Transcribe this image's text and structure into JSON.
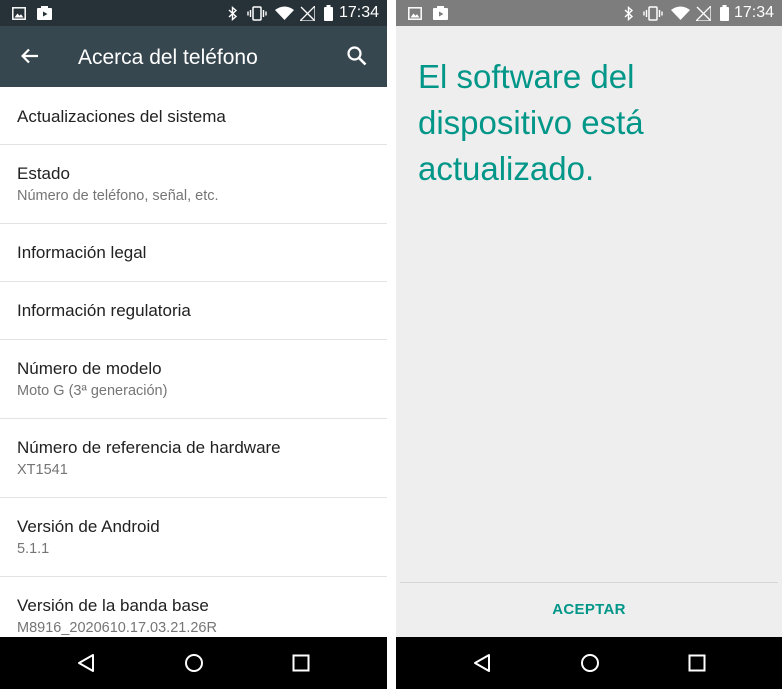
{
  "status_bar": {
    "time": "17:34"
  },
  "left_screen": {
    "title": "Acerca del teléfono",
    "items": [
      {
        "title": "Actualizaciones del sistema"
      },
      {
        "title": "Estado",
        "subtitle": "Número de teléfono, señal, etc."
      },
      {
        "title": "Información legal"
      },
      {
        "title": "Información regulatoria"
      },
      {
        "title": "Número de modelo",
        "subtitle": "Moto G (3ª generación)"
      },
      {
        "title": "Número de referencia de hardware",
        "subtitle": "XT1541"
      },
      {
        "title": "Versión de Android",
        "subtitle": "5.1.1"
      },
      {
        "title": "Versión de la banda base",
        "subtitle": "M8916_2020610.17.03.21.26R"
      }
    ]
  },
  "right_screen": {
    "message": "El software del dispositivo está actualizado.",
    "button_label": "ACEPTAR"
  },
  "colors": {
    "accent": "#009688",
    "app_bar": "#37474f",
    "status_bar_left": "#263238",
    "status_bar_right": "#7d7d7d"
  },
  "icons": {
    "status_bar": [
      "image-icon",
      "media-icon",
      "bluetooth-icon",
      "vibrate-icon",
      "wifi-icon",
      "no-signal-icon",
      "battery-icon"
    ],
    "app_bar": [
      "back-arrow-icon",
      "search-icon"
    ],
    "navigation": [
      "back-triangle-icon",
      "home-circle-icon",
      "recents-square-icon"
    ]
  }
}
